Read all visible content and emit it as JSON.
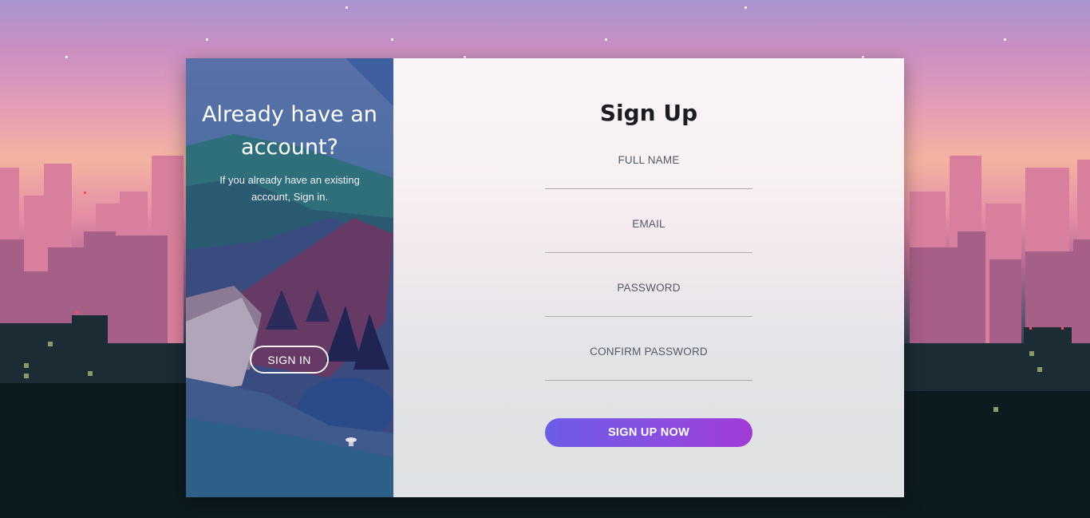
{
  "left_panel": {
    "title": "Already have an account?",
    "subtitle": "If you already have an existing account, Sign in.",
    "sign_in_label": "SIGN IN"
  },
  "form": {
    "title": "Sign Up",
    "fields": [
      {
        "label": "FULL NAME",
        "value": ""
      },
      {
        "label": "EMAIL",
        "value": ""
      },
      {
        "label": "PASSWORD",
        "value": ""
      },
      {
        "label": "CONFIRM PASSWORD",
        "value": ""
      }
    ],
    "submit_label": "SIGN UP NOW"
  },
  "colors": {
    "button_gradient_start": "#6c5de8",
    "button_gradient_end": "#a23bd6",
    "left_panel_blue": "#3a5f8c"
  }
}
